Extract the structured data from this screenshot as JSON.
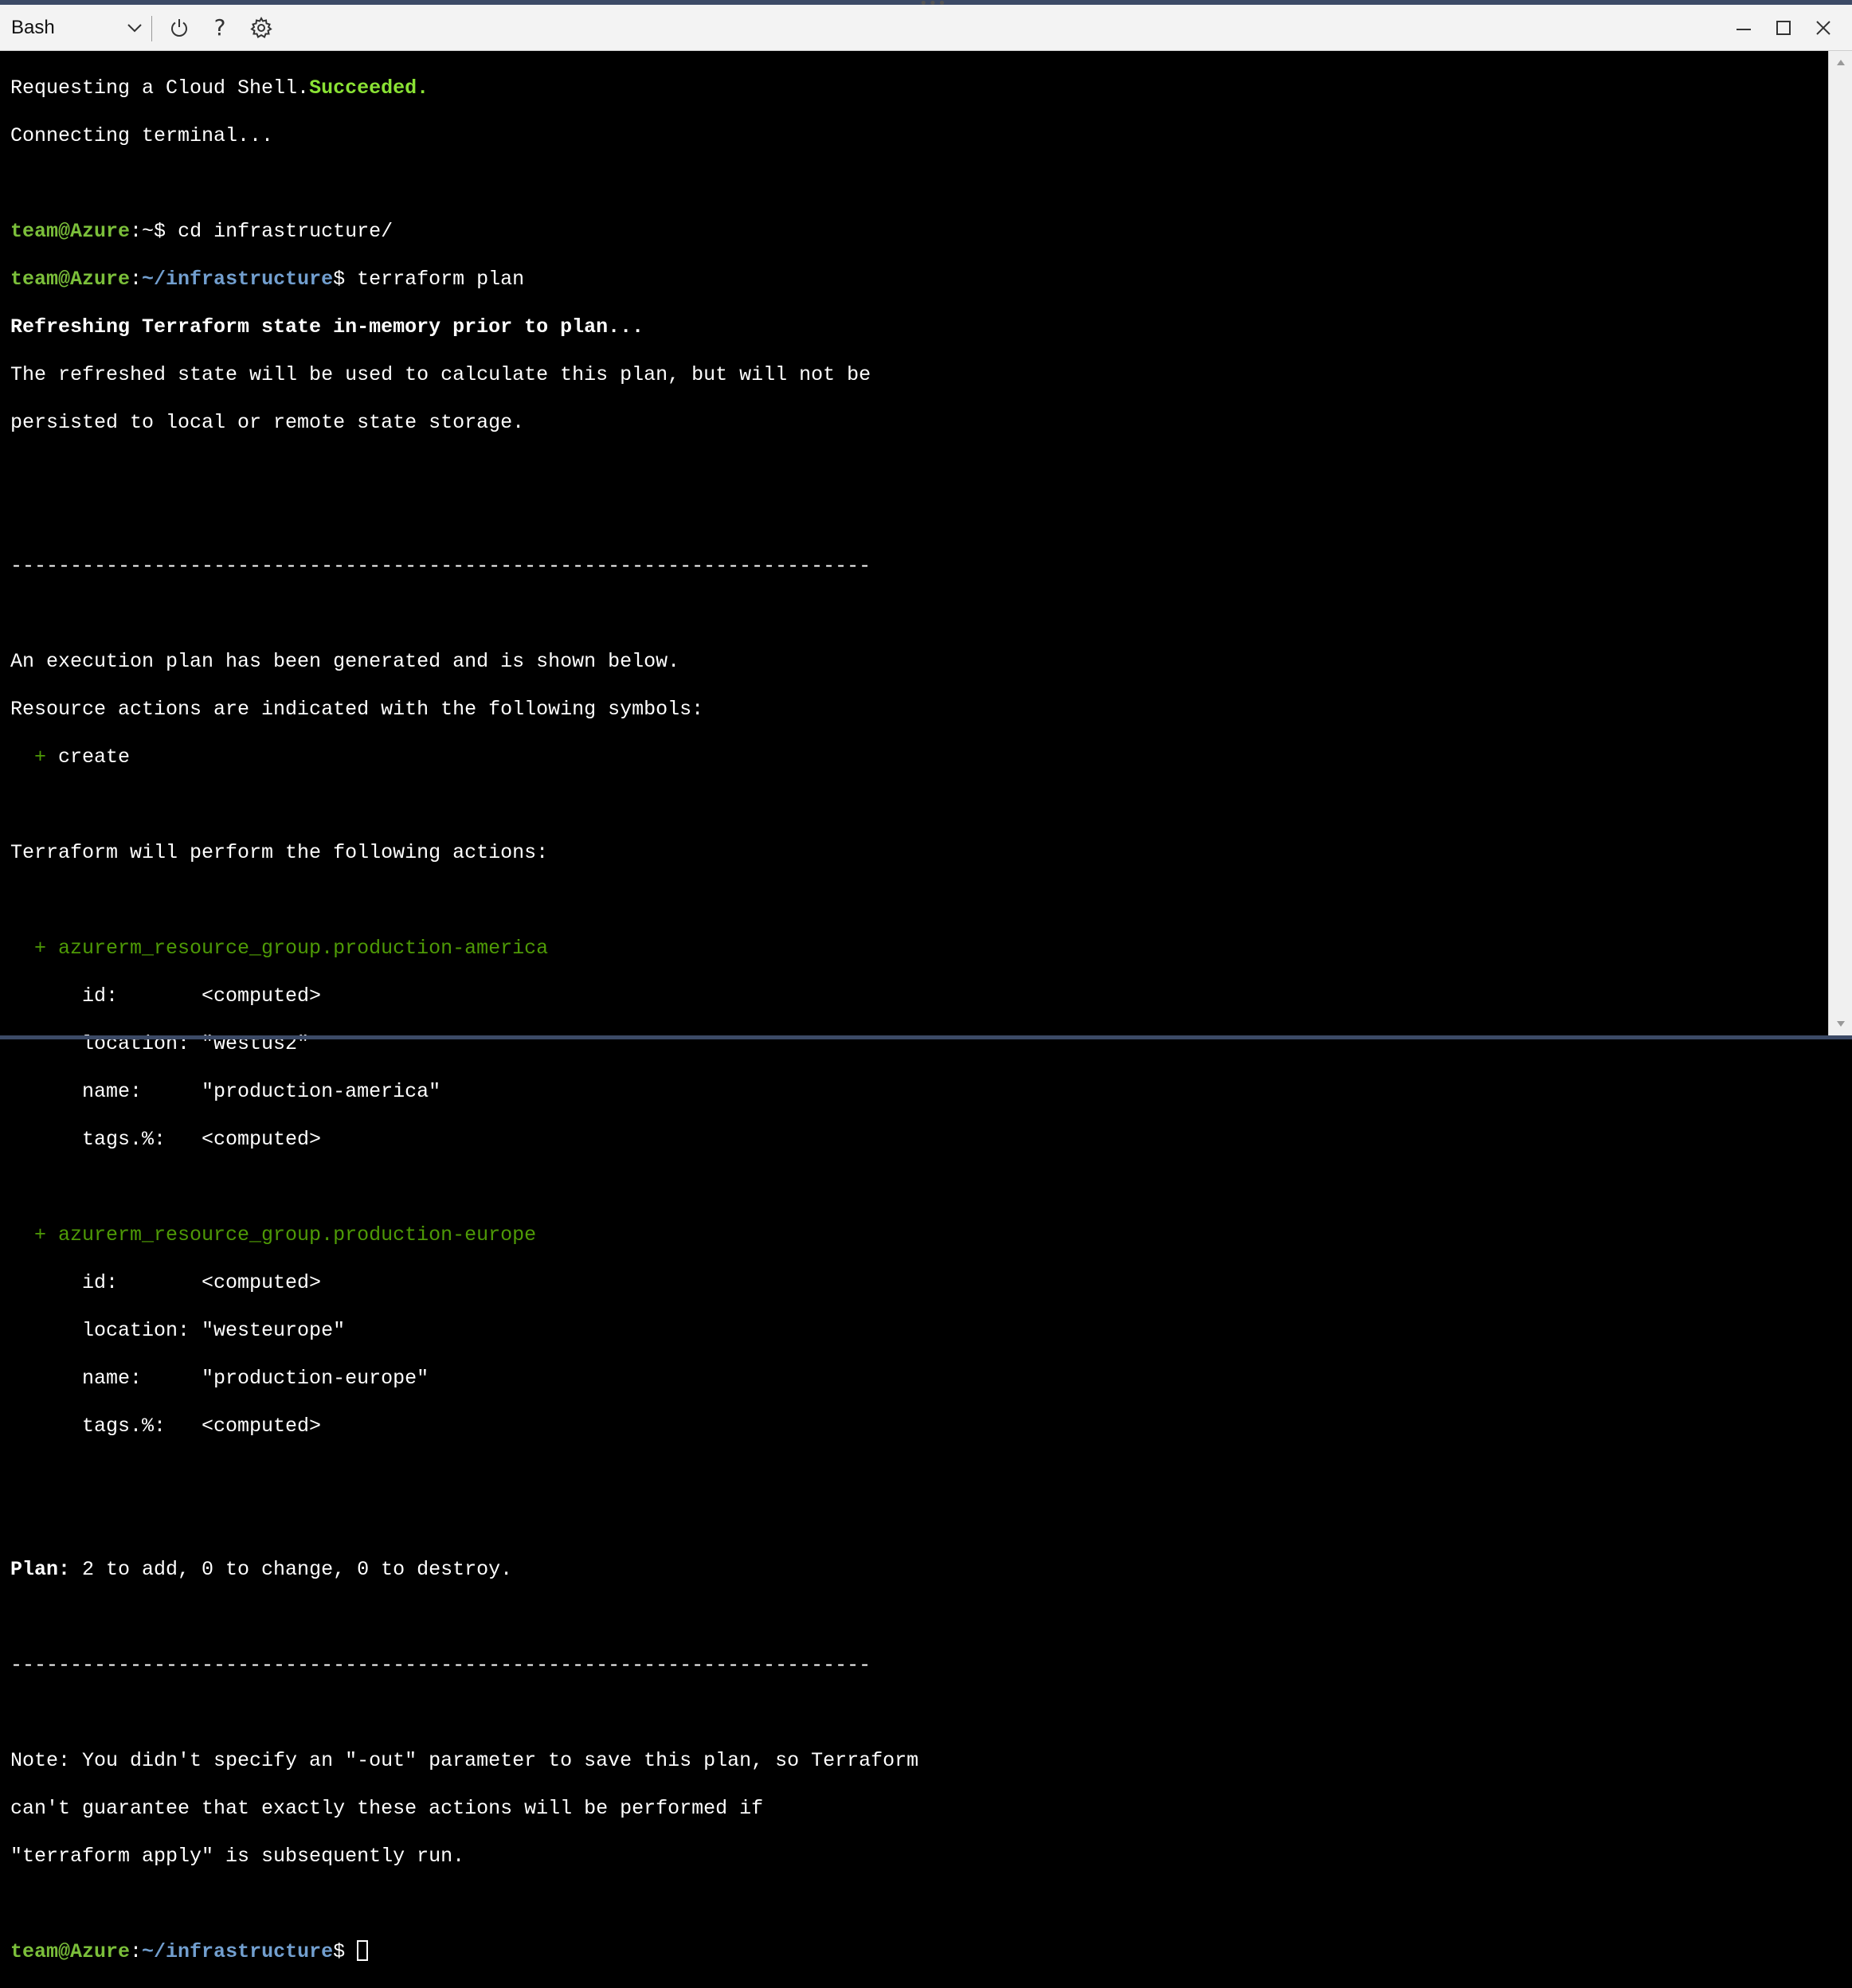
{
  "toolbar": {
    "shell": "Bash",
    "restart_tooltip": "Restart",
    "help_glyph": "?",
    "settings_tooltip": "Settings"
  },
  "window_controls": {
    "minimize": "Minimize",
    "maximize": "Maximize",
    "close": "Close"
  },
  "terminal": {
    "l1_a": "Requesting a Cloud Shell.",
    "l1_b": "Succeeded.",
    "l2": "Connecting terminal...",
    "prompt_user": "team@Azure",
    "prompt_home": ":~",
    "prompt_sep": ":",
    "prompt_dir": "~/infrastructure",
    "prompt_dollar": "$",
    "cmd1": " cd infrastructure/",
    "cmd2": " terraform plan",
    "refresh_bold": "Refreshing Terraform state in-memory prior to plan...",
    "refresh_1": "The refreshed state will be used to calculate this plan, but will not be",
    "refresh_2": "persisted to local or remote state storage.",
    "divider": "------------------------------------------------------------------------",
    "exec_1": "An execution plan has been generated and is shown below.",
    "exec_2": "Resource actions are indicated with the following symbols:",
    "sym_plus": "  +",
    "sym_create": " create",
    "perform": "Terraform will perform the following actions:",
    "res1_name": "  + azurerm_resource_group.production-america",
    "res1_id": "      id:       <computed>",
    "res1_loc": "      location: \"westus2\"",
    "res1_nm": "      name:     \"production-america\"",
    "res1_tags": "      tags.%:   <computed>",
    "res2_name": "  + azurerm_resource_group.production-europe",
    "res2_id": "      id:       <computed>",
    "res2_loc": "      location: \"westeurope\"",
    "res2_nm": "      name:     \"production-europe\"",
    "res2_tags": "      tags.%:   <computed>",
    "plan_label": "Plan:",
    "plan_text": " 2 to add, 0 to change, 0 to destroy.",
    "note_1": "Note: You didn't specify an \"-out\" parameter to save this plan, so Terraform",
    "note_2": "can't guarantee that exactly these actions will be performed if",
    "note_3": "\"terraform apply\" is subsequently run."
  },
  "colors": {
    "prompt_green": "#8ae234",
    "path_blue": "#729fcf",
    "plan_green": "#4e9a06",
    "toolbar_bg": "#f3f3f3"
  },
  "icons": {
    "shell_dropdown": "chevron-down-icon",
    "restart": "power-icon",
    "help": "help-icon",
    "settings": "gear-icon",
    "minimize": "minimize-icon",
    "maximize": "maximize-icon",
    "close": "close-icon"
  }
}
